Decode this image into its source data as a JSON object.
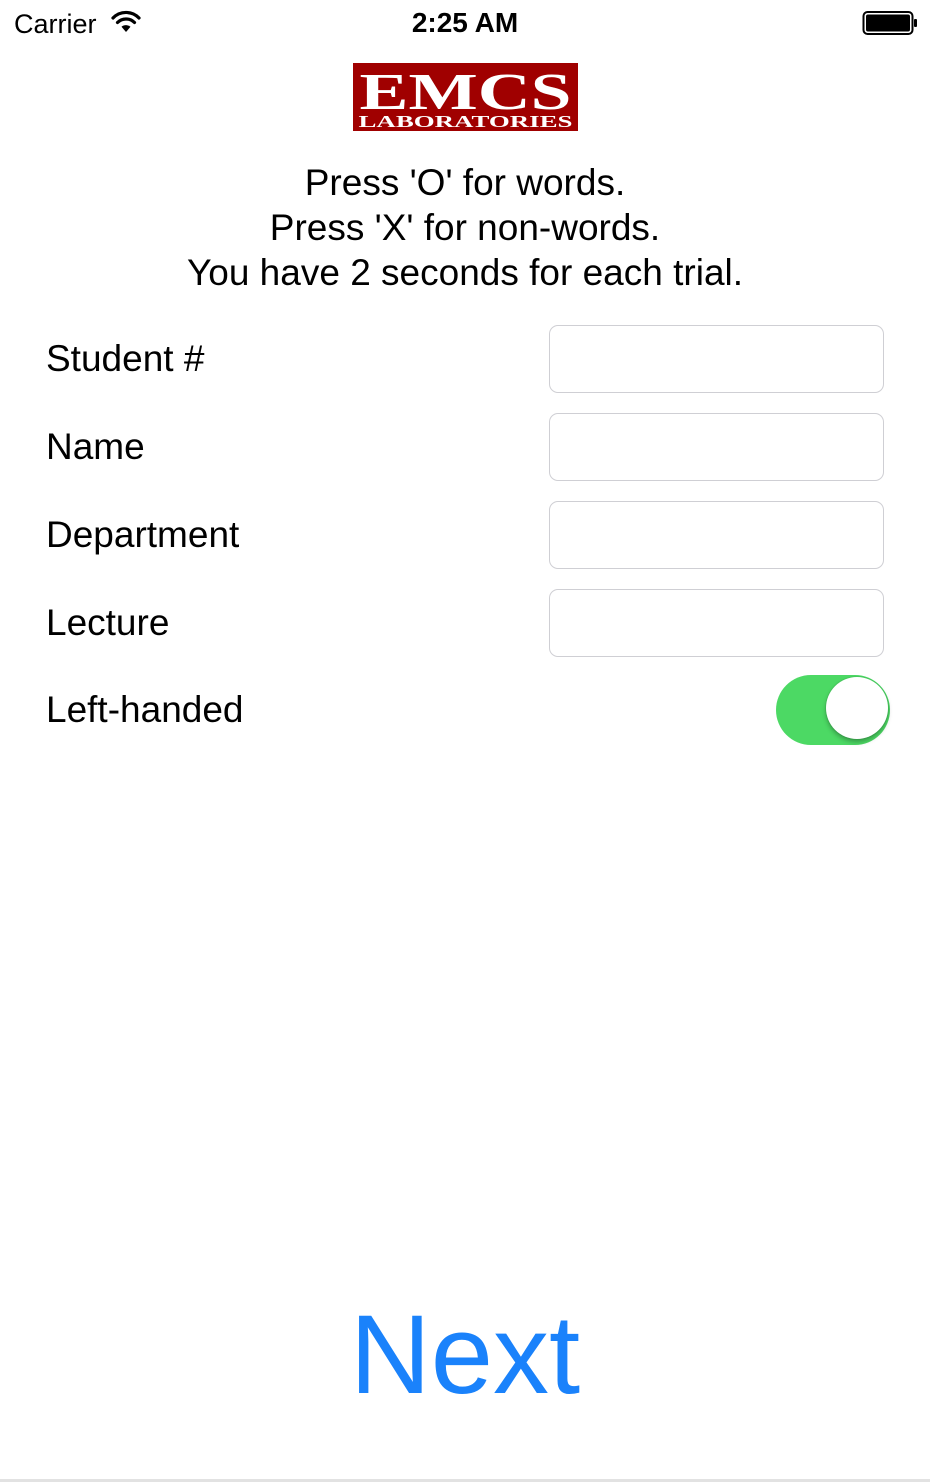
{
  "status_bar": {
    "carrier": "Carrier",
    "time": "2:25 AM",
    "wifi_icon": "wifi-icon",
    "battery_icon": "battery-icon"
  },
  "logo": {
    "line1": "EMCS",
    "line2": "LABORATORIES",
    "color": "#a00000"
  },
  "instructions": [
    "Press 'O' for words.",
    "Press 'X' for non-words.",
    "You have 2 seconds for each trial."
  ],
  "form": {
    "student_number_label": "Student #",
    "student_number_value": "",
    "name_label": "Name",
    "name_value": "",
    "department_label": "Department",
    "department_value": "",
    "lecture_label": "Lecture",
    "lecture_value": "",
    "left_handed_label": "Left-handed",
    "left_handed_on": true
  },
  "next_label": "Next",
  "colors": {
    "accent": "#1a82fb",
    "toggle_on": "#4cd964",
    "field_border": "#cfcfd4"
  }
}
